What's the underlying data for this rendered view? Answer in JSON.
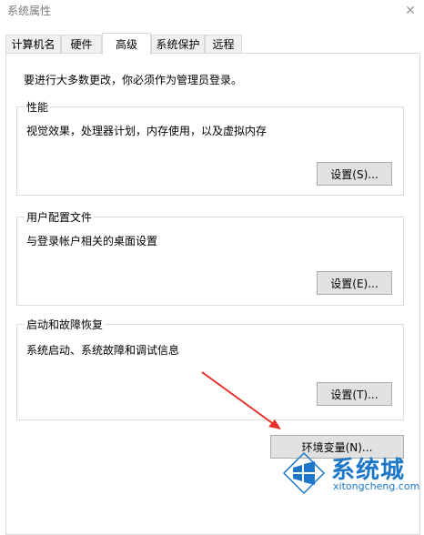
{
  "window": {
    "title": "系统属性",
    "close_glyph": "✕"
  },
  "tabs": [
    {
      "label": "计算机名",
      "active": false
    },
    {
      "label": "硬件",
      "active": false
    },
    {
      "label": "高级",
      "active": true
    },
    {
      "label": "系统保护",
      "active": false
    },
    {
      "label": "远程",
      "active": false
    }
  ],
  "advanced": {
    "admin_notice": "要进行大多数更改，你必须作为管理员登录。",
    "performance": {
      "legend": "性能",
      "description": "视觉效果，处理器计划，内存使用，以及虚拟内存",
      "button": "设置(S)..."
    },
    "user_profiles": {
      "legend": "用户配置文件",
      "description": "与登录帐户相关的桌面设置",
      "button": "设置(E)..."
    },
    "startup_recovery": {
      "legend": "启动和故障恢复",
      "description": "系统启动、系统故障和调试信息",
      "button": "设置(T)..."
    },
    "env_vars_button": "环境变量(N)..."
  },
  "watermark": {
    "main": "系统城",
    "sub": "xitongcheng.com"
  },
  "colors": {
    "arrow": "#e8302a",
    "watermark": "#1d77c8"
  }
}
